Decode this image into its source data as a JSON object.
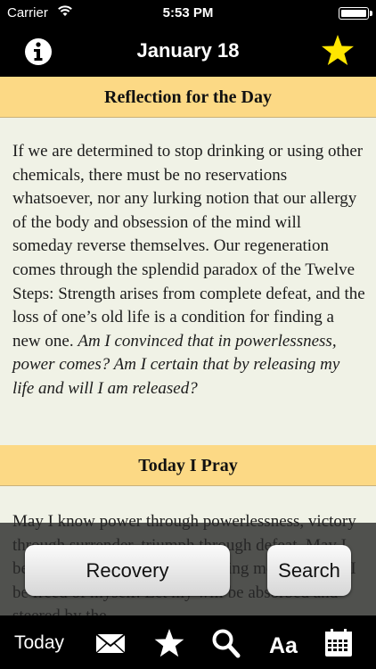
{
  "status_bar": {
    "carrier": "Carrier",
    "time": "5:53 PM"
  },
  "nav": {
    "title": "January 18",
    "info_icon": "info-icon",
    "star_icon": "star-icon",
    "star_color": "#ffe600"
  },
  "reflection": {
    "header": "Reflection for the Day",
    "body": "If we are determined to stop drinking or using other chemicals, there must be no reservations whatsoever, nor any lurking notion that our allergy of the body and obsession of the mind will someday reverse themselves. Our regeneration comes through the splendid paradox of the Twelve Steps: Strength arises from complete defeat, and the loss of one’s old life is a condition for finding a new one.",
    "question": "Am I convinced that in powerlessness, power comes? Am I certain that by releasing my life and will I am released?"
  },
  "prayer": {
    "header": "Today I Pray",
    "body": "May I know power through powerlessness, victory through surrender, triumph through defeat. May I be freed of selfish and self-seeking motives. May I be freed of myself. Let my will be absorbed and steered by the"
  },
  "buttons": {
    "recovery": "Recovery",
    "search": "Search"
  },
  "tabs": {
    "today": "Today",
    "icons": [
      "mail-icon",
      "star-icon",
      "search-icon",
      "font-size-icon",
      "calendar-icon"
    ],
    "font_label": "Aa"
  },
  "colors": {
    "header_bg": "#fcd985",
    "content_bg": "#f0f2e6",
    "bar_bg": "#000000"
  }
}
